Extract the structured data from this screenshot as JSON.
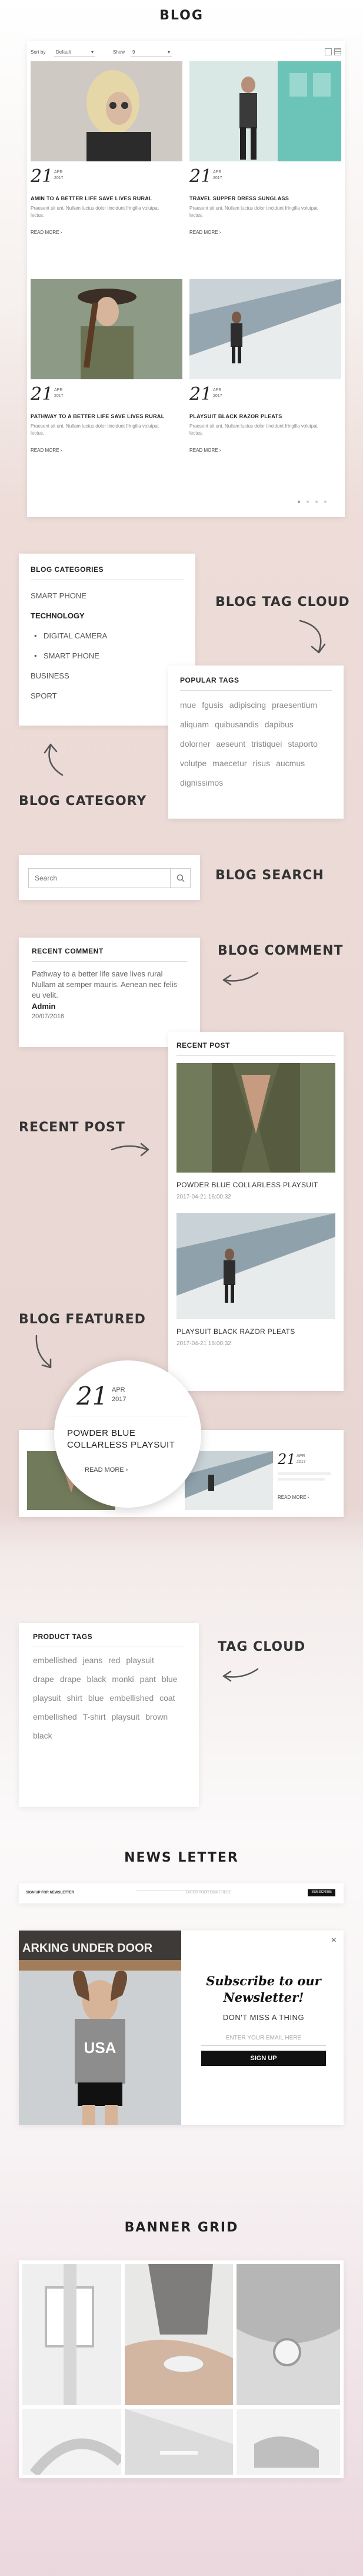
{
  "blog": {
    "title": "BLOG",
    "sortby_label": "Sort by",
    "sortby_value": "Default",
    "show_label": "Show",
    "show_value": "9",
    "posts": [
      {
        "day": "21",
        "month": "APR",
        "year": "2017",
        "title": "AMIN TO A BETTER LIFE SAVE LIVES RURAL",
        "excerpt": "Praesent sit unt. Nullam luctus dolor tincidunt fringilla volutpat lectus.",
        "readmore": "READ MORE"
      },
      {
        "day": "21",
        "month": "APR",
        "year": "2017",
        "title": "TRAVEL SUPPER DRESS SUNGLASS",
        "excerpt": "Praesent sit unt. Nullam luctus dolor tincidunt fringilla volutpat lectus.",
        "readmore": "READ MORE"
      },
      {
        "day": "21",
        "month": "APR",
        "year": "2017",
        "title": "PATHWAY TO A BETTER LIFE SAVE LIVES RURAL",
        "excerpt": "Praesent sit unt. Nullam luctus dolor tincidunt fringilla volutpat lectus.",
        "readmore": "READ MORE"
      },
      {
        "day": "21",
        "month": "APR",
        "year": "2017",
        "title": "PLAYSUIT BLACK RAZOR PLEATS",
        "excerpt": "Praesent sit unt. Nullam luctus dolor tincidunt fringilla volutpat lectus.",
        "readmore": "READ MORE"
      }
    ]
  },
  "categories": {
    "title": "BLOG CATEGORIES",
    "items": [
      "SMART PHONE",
      "TECHNOLOGY",
      "DIGITAL CAMERA",
      "SMART PHONE",
      "BUSINESS",
      "SPORT"
    ],
    "callout": "BLOG CATEGORY"
  },
  "tagcloud": {
    "callout": "BLOG TAG CLOUD",
    "title": "POPULAR TAGS",
    "tags": [
      "mue",
      "fgusis",
      "adipiscing",
      "praesentium",
      "aliquam",
      "quibusandis",
      "dapibus",
      "dolorner",
      "aeseunt",
      "tristiquei",
      "staporto",
      "volutpe",
      "maecetur",
      "risus",
      "aucmus",
      "dignissimos"
    ]
  },
  "search": {
    "placeholder": "Search",
    "callout": "BLOG SEARCH"
  },
  "comment": {
    "title": "RECENT COMMENT",
    "text": "Pathway to a better life save lives rural Nullam at semper mauris. Aenean nec felis eu velit.",
    "author": "Admin",
    "date": "20/07/2016",
    "callout": "BLOG COMMENT"
  },
  "recent": {
    "callout": "RECENT POST",
    "title": "RECENT POST",
    "posts": [
      {
        "title": "POWDER BLUE COLLARLESS PLAYSUIT",
        "date": "2017-04-21 16:00:32"
      },
      {
        "title": "PLAYSUIT BLACK RAZOR PLEATS",
        "date": "2017-04-21 16:00:32"
      }
    ]
  },
  "featured": {
    "callout": "BLOG FEATURED",
    "day": "21",
    "month": "APR",
    "year": "2017",
    "title": "POWDER BLUE COLLARLESS PLAYSUIT",
    "readmore": "READ MORE",
    "small_day": "21"
  },
  "producttags": {
    "title": "PRODUCT TAGS",
    "callout": "TAG CLOUD",
    "tags": [
      "embellished",
      "jeans",
      "red",
      "playsuit",
      "drape",
      "drape",
      "black",
      "monki",
      "pant",
      "blue",
      "playsuit",
      "shirt",
      "blue",
      "embellished",
      "coat",
      "embellished",
      "T-shirt",
      "playsuit",
      "brown",
      "black"
    ]
  },
  "newsletter": {
    "section": "NEWS LETTER",
    "subscribe_heading": "Subscribe to our Newsletter!",
    "dont_miss": "DON'T MISS A THING",
    "email_placeholder": "ENTER YOUR EMAIL HERE",
    "signup": "SIGN UP",
    "sign_label": "SIGN UP FOR NEWSLETTER",
    "subscribe_btn": "SUBSCRIBE",
    "shirt_text": "USA",
    "sign_text": "ARKING UNDER DOOR"
  },
  "banner": {
    "section": "BANNER GRID"
  },
  "colors": {
    "accent": "#111111",
    "bg_pink": "#e8d6d2"
  }
}
